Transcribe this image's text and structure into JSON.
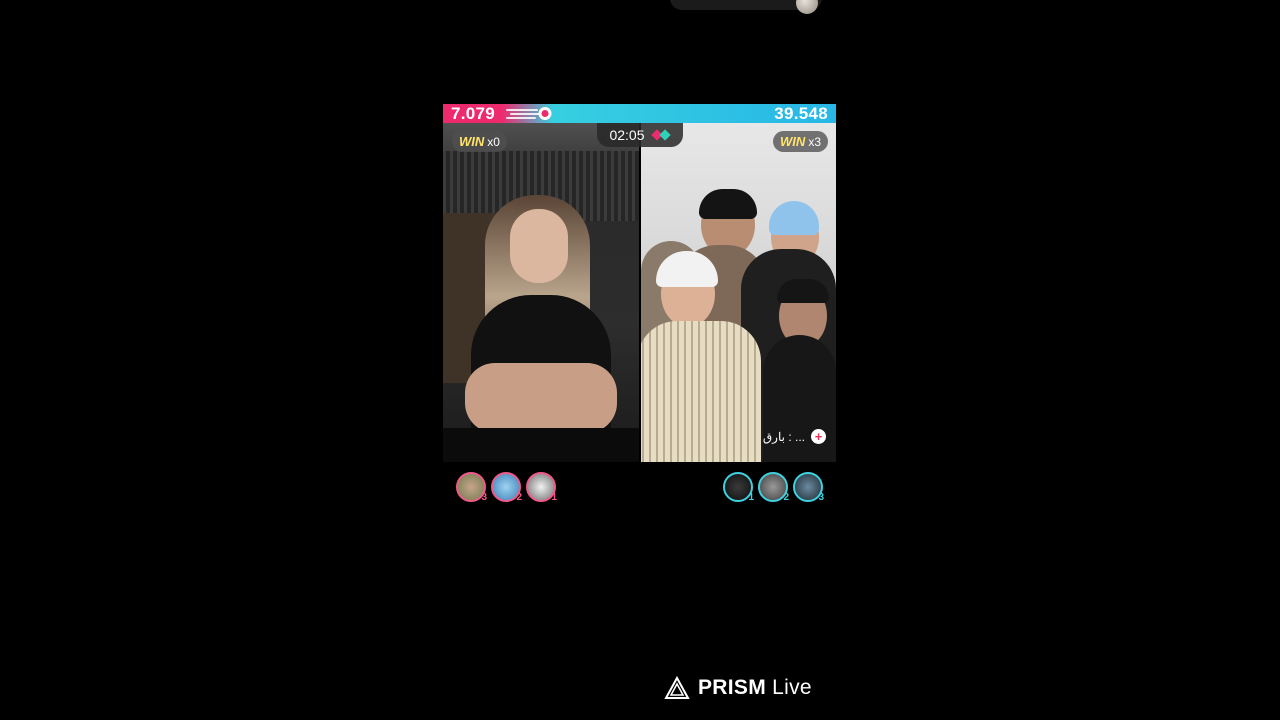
{
  "battle": {
    "left_score": "7.079",
    "right_score": "39.548",
    "timer": "02:05",
    "left_win": {
      "label": "WIN",
      "count": "x0"
    },
    "right_win": {
      "label": "WIN",
      "count": "x3"
    },
    "comment": "بارق : ..."
  },
  "supporters": {
    "left": [
      {
        "rank": "3"
      },
      {
        "rank": "2"
      },
      {
        "rank": "1"
      }
    ],
    "right": [
      {
        "rank": "1"
      },
      {
        "rank": "2"
      },
      {
        "rank": "3"
      }
    ]
  },
  "watermark": {
    "brand": "PRISM",
    "suffix": "Live"
  },
  "colors": {
    "pink": "#ee2a6f",
    "cyan": "#27b7e6",
    "win_yellow": "#ffe36a"
  }
}
